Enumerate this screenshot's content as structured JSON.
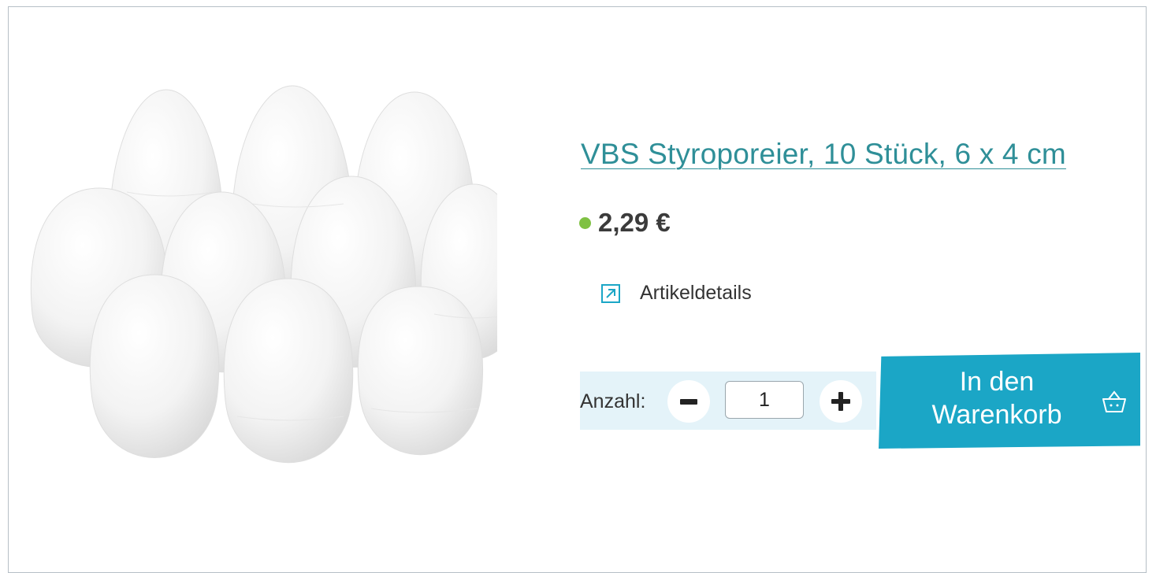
{
  "product": {
    "title": "VBS Styroporeier, 10 Stück, 6 x 4 cm",
    "price": "2,29 €",
    "stock_color": "#7fc143",
    "image_icon": "product-image"
  },
  "details_link": {
    "label": "Artikeldetails",
    "icon": "external-link-icon"
  },
  "quantity": {
    "label": "Anzahl:",
    "value": "1",
    "minus_icon": "minus-icon",
    "plus_icon": "plus-icon"
  },
  "cart_button": {
    "label": "In den\nWarenkorb",
    "icon": "basket-icon",
    "color": "#1ba6c6"
  },
  "colors": {
    "accent": "#1ba6c6",
    "title": "#2f8f98",
    "panel": "#e4f3f9"
  }
}
